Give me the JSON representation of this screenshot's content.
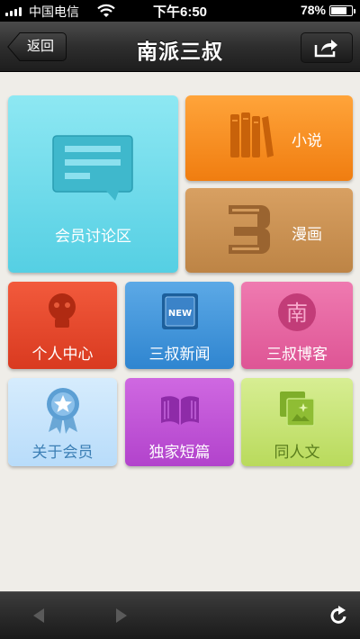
{
  "status_bar": {
    "carrier": "中国电信",
    "time": "下午6:50",
    "battery": "78%"
  },
  "nav": {
    "title": "南派三叔",
    "back_label": "返回"
  },
  "tiles": {
    "forum": "会员讨论区",
    "novel": "小说",
    "comic": "漫画",
    "personal": "个人中心",
    "news": "三叔新闻",
    "news_badge": "NEW",
    "blog": "三叔博客",
    "blog_badge": "南",
    "about": "关于会员",
    "short": "独家短篇",
    "fanfic": "同人文"
  },
  "colors": {
    "forum": "#55cfe3",
    "novel": "#f07d10",
    "comic": "#bd8445",
    "personal": "#d93a20",
    "news": "#2f85d0",
    "blog": "#de5595",
    "about": "#b8dcfa",
    "short": "#b243cc",
    "fanfic": "#b9da5c"
  }
}
